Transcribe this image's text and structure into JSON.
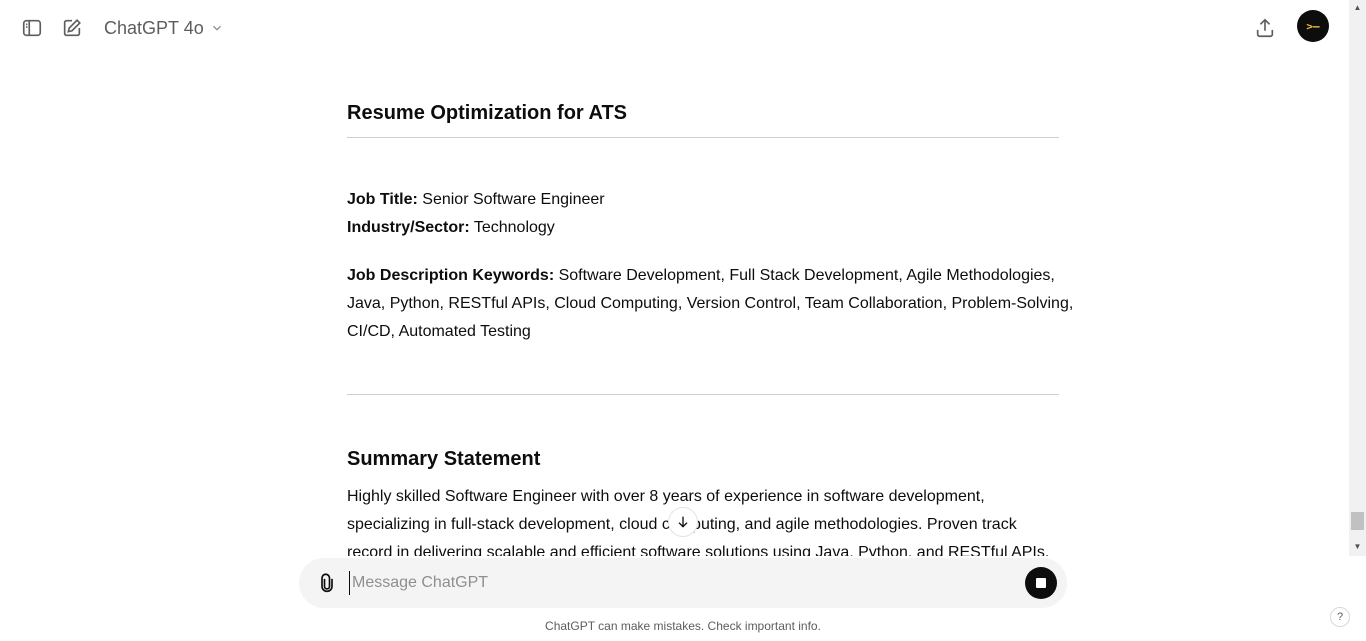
{
  "header": {
    "model_name": "ChatGPT 4o",
    "avatar_text": ">—"
  },
  "article": {
    "heading1": "Resume Optimization for ATS",
    "job_title_label": "Job Title:",
    "job_title_value": " Senior Software Engineer",
    "industry_label": "Industry/Sector:",
    "industry_value": " Technology",
    "keywords_label": "Job Description Keywords:",
    "keywords_line1": " Software Development, Full Stack Development, Agile Methodologies,",
    "keywords_line2": "Java, Python, RESTful APIs, Cloud Computing, Version Control, Team Collaboration, Problem-Solving,",
    "keywords_line3": "CI/CD, Automated Testing",
    "heading2": "Summary Statement",
    "summary_line1": "Highly skilled Software Engineer with over 8 years of experience in software development,",
    "summary_line2": "specializing in full-stack development, cloud computing, and agile methodologies. Proven track",
    "summary_line3": "record in delivering scalable and efficient software solutions using Java, Python, and RESTful APIs."
  },
  "composer": {
    "placeholder": "Message ChatGPT"
  },
  "footer": {
    "disclaimer": "ChatGPT can make mistakes. Check important info.",
    "help": "?"
  },
  "icons": {
    "sidebar_toggle": "sidebar-icon",
    "new_chat": "edit-icon",
    "share": "share-icon",
    "attach": "paperclip-icon",
    "stop": "stop-icon",
    "scroll_down": "arrow-down-icon"
  }
}
